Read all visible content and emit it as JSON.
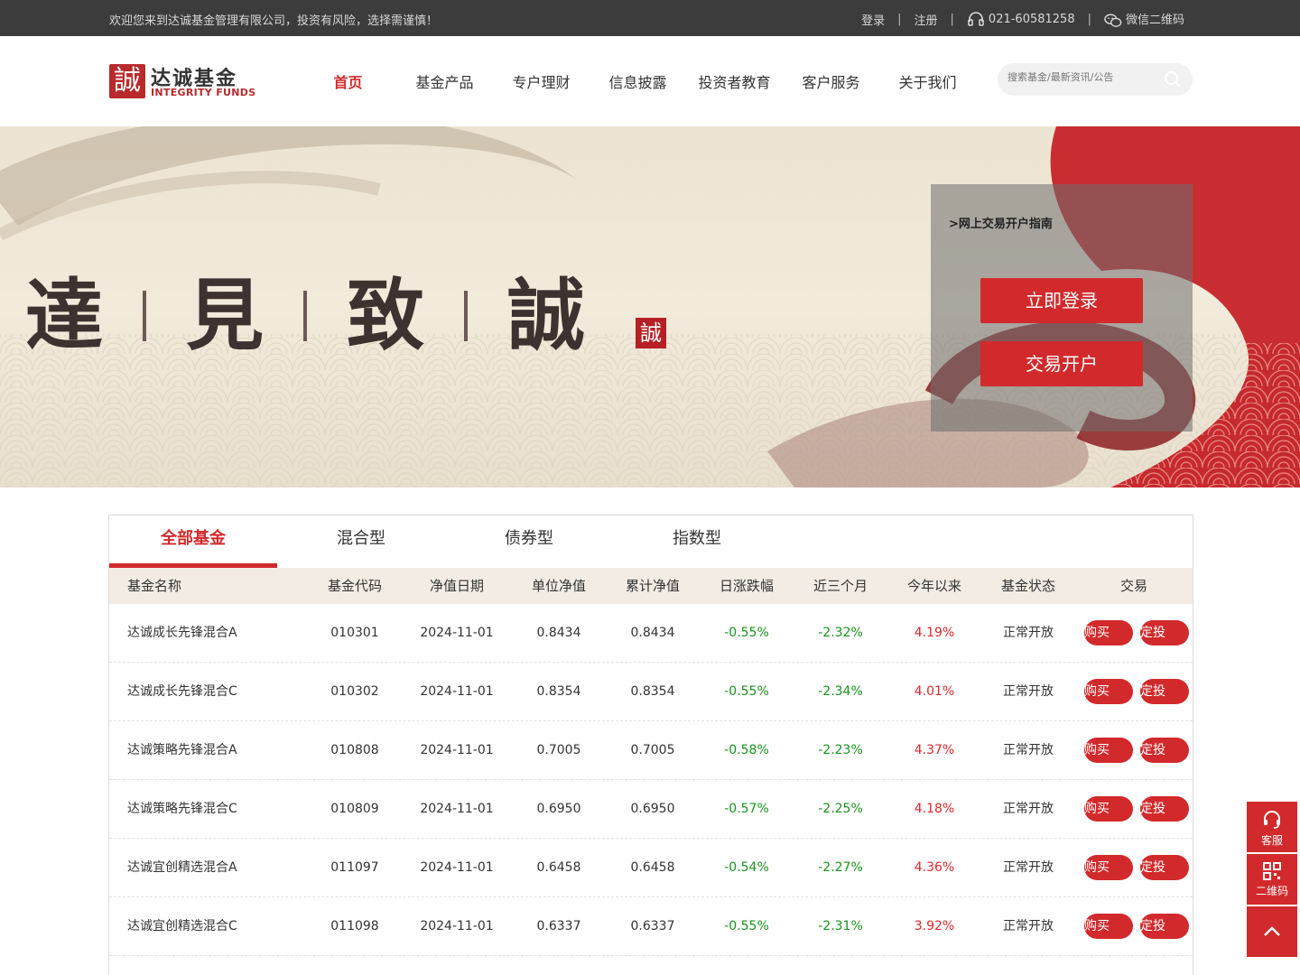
{
  "topbar": {
    "welcome": "欢迎您来到达诚基金管理有限公司，投资有风险，选择需谨慎！",
    "login": "登录",
    "register": "注册",
    "phone": "021-60581258",
    "wechat": "微信二维码",
    "separator": "|"
  },
  "logo": {
    "cn": "达诚基金",
    "en": "INTEGRITY FUNDS",
    "mark": "誠"
  },
  "nav": [
    "首页",
    "基金产品",
    "专户理财",
    "信息披露",
    "投资者教育",
    "客户服务",
    "关于我们"
  ],
  "search": {
    "placeholder": "搜索基金/最新资讯/公告"
  },
  "banner": {
    "slogan": [
      "達",
      "見",
      "致",
      "誠"
    ],
    "seal": "誠",
    "guide": ">网上交易开户指南",
    "login_button": "立即登录",
    "open_button": "交易开户"
  },
  "tabs": [
    "全部基金",
    "混合型",
    "债券型",
    "指数型"
  ],
  "table": {
    "headers": [
      "基金名称",
      "基金代码",
      "净值日期",
      "单位净值",
      "累计净值",
      "日涨跌幅",
      "近三个月",
      "今年以来",
      "基金状态",
      "交易"
    ],
    "buy_label": "购买",
    "plan_label": "定投",
    "rows": [
      {
        "name": "达诚成长先锋混合A",
        "code": "010301",
        "date": "2024-11-01",
        "nav": "0.8434",
        "acc": "0.8434",
        "day": "-0.55%",
        "m3": "-2.32%",
        "ytd": "4.19%",
        "status": "正常开放"
      },
      {
        "name": "达诚成长先锋混合C",
        "code": "010302",
        "date": "2024-11-01",
        "nav": "0.8354",
        "acc": "0.8354",
        "day": "-0.55%",
        "m3": "-2.34%",
        "ytd": "4.01%",
        "status": "正常开放"
      },
      {
        "name": "达诚策略先锋混合A",
        "code": "010808",
        "date": "2024-11-01",
        "nav": "0.7005",
        "acc": "0.7005",
        "day": "-0.58%",
        "m3": "-2.23%",
        "ytd": "4.37%",
        "status": "正常开放"
      },
      {
        "name": "达诚策略先锋混合C",
        "code": "010809",
        "date": "2024-11-01",
        "nav": "0.6950",
        "acc": "0.6950",
        "day": "-0.57%",
        "m3": "-2.25%",
        "ytd": "4.18%",
        "status": "正常开放"
      },
      {
        "name": "达诚宜创精选混合A",
        "code": "011097",
        "date": "2024-11-01",
        "nav": "0.6458",
        "acc": "0.6458",
        "day": "-0.54%",
        "m3": "-2.27%",
        "ytd": "4.36%",
        "status": "正常开放"
      },
      {
        "name": "达诚宜创精选混合C",
        "code": "011098",
        "date": "2024-11-01",
        "nav": "0.6337",
        "acc": "0.6337",
        "day": "-0.55%",
        "m3": "-2.31%",
        "ytd": "3.92%",
        "status": "正常开放"
      }
    ]
  },
  "side": {
    "service": "客服",
    "qrcode": "二维码"
  },
  "colors": {
    "brand_red": "#d22a2c",
    "up": "#e0262b",
    "down": "#18931b",
    "topbar": "#3c3c3c",
    "header_row": "#f3ece4"
  },
  "icons": [
    "headset-icon",
    "wechat-icon",
    "search-icon",
    "customer-service-icon",
    "qrcode-icon",
    "back-to-top-icon"
  ]
}
